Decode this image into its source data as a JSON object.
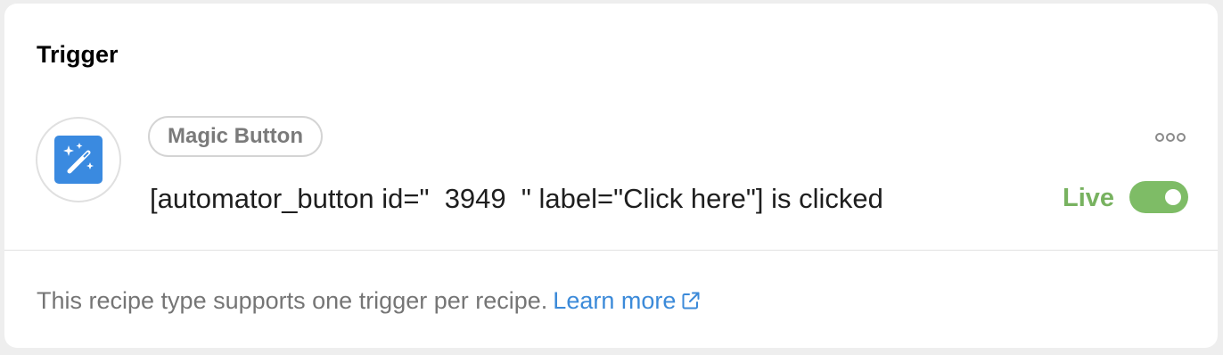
{
  "trigger_card": {
    "title": "Trigger",
    "integration": {
      "name": "Magic Button",
      "icon": "magic-wand-icon",
      "icon_bg_color": "#3a8ae0"
    },
    "sentence": "[automator_button id=\"  3949  \" label=\"Click here\"] is clicked",
    "more_icon": "ellipsis-icon",
    "status": {
      "label": "Live",
      "enabled": true,
      "color": "#7ebc66"
    }
  },
  "footer": {
    "note": "This recipe type supports one trigger per recipe.",
    "link_label": "Learn more",
    "link_icon": "external-link-icon",
    "link_color": "#3b8ad9"
  }
}
